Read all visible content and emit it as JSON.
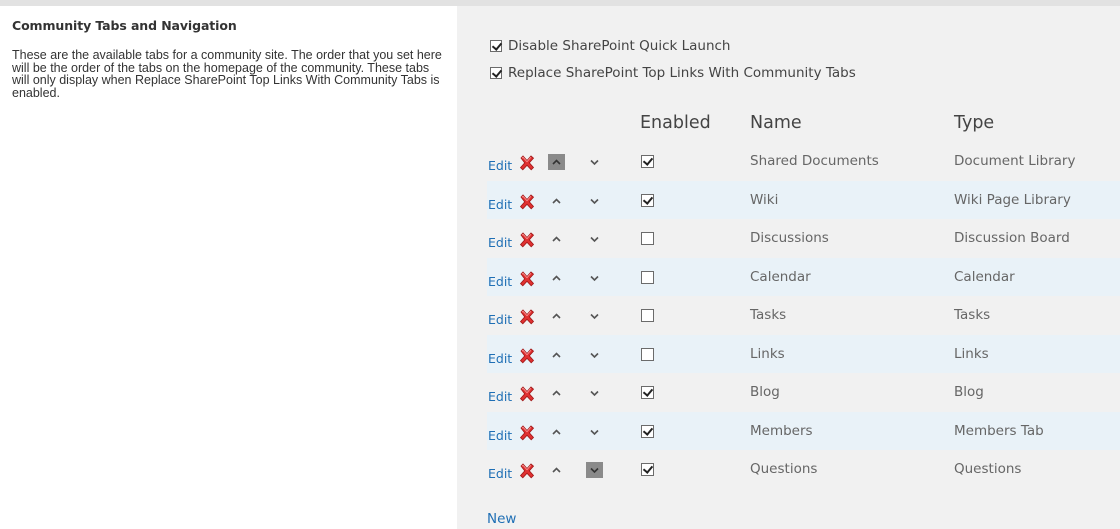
{
  "section": {
    "title": "Community Tabs and Navigation",
    "description": "These are the available tabs for a community site. The order that you set here will be the order of the tabs on the homepage of the community. These tabs will only display when Replace SharePoint Top Links With Community Tabs is enabled."
  },
  "options": {
    "disable_quick_launch": {
      "label": "Disable SharePoint Quick Launch",
      "checked": true
    },
    "replace_top_links": {
      "label": "Replace SharePoint Top Links With Community Tabs",
      "checked": true
    }
  },
  "table": {
    "columns": {
      "enabled": "Enabled",
      "name": "Name",
      "type": "Type"
    },
    "edit_label": "Edit",
    "rows": [
      {
        "name": "Shared Documents",
        "type": "Document Library",
        "enabled": true,
        "up_highlighted": true,
        "down_highlighted": false
      },
      {
        "name": "Wiki",
        "type": "Wiki Page Library",
        "enabled": true,
        "up_highlighted": false,
        "down_highlighted": false
      },
      {
        "name": "Discussions",
        "type": "Discussion Board",
        "enabled": false,
        "up_highlighted": false,
        "down_highlighted": false
      },
      {
        "name": "Calendar",
        "type": "Calendar",
        "enabled": false,
        "up_highlighted": false,
        "down_highlighted": false
      },
      {
        "name": "Tasks",
        "type": "Tasks",
        "enabled": false,
        "up_highlighted": false,
        "down_highlighted": false
      },
      {
        "name": "Links",
        "type": "Links",
        "enabled": false,
        "up_highlighted": false,
        "down_highlighted": false
      },
      {
        "name": "Blog",
        "type": "Blog",
        "enabled": true,
        "up_highlighted": false,
        "down_highlighted": false
      },
      {
        "name": "Members",
        "type": "Members Tab",
        "enabled": true,
        "up_highlighted": false,
        "down_highlighted": false
      },
      {
        "name": "Questions",
        "type": "Questions",
        "enabled": true,
        "up_highlighted": false,
        "down_highlighted": true
      }
    ]
  },
  "new_label": "New",
  "colors": {
    "link": "#1f6fb5",
    "panel_bg": "#f1f1f1",
    "alt_row_bg": "#e9f2f8",
    "delete_red": "#e03131",
    "arrow_box": "#8a8a8a"
  },
  "icons": {
    "delete": "red-x-delete-icon",
    "up": "chevron-up-icon",
    "down": "chevron-down-icon"
  }
}
